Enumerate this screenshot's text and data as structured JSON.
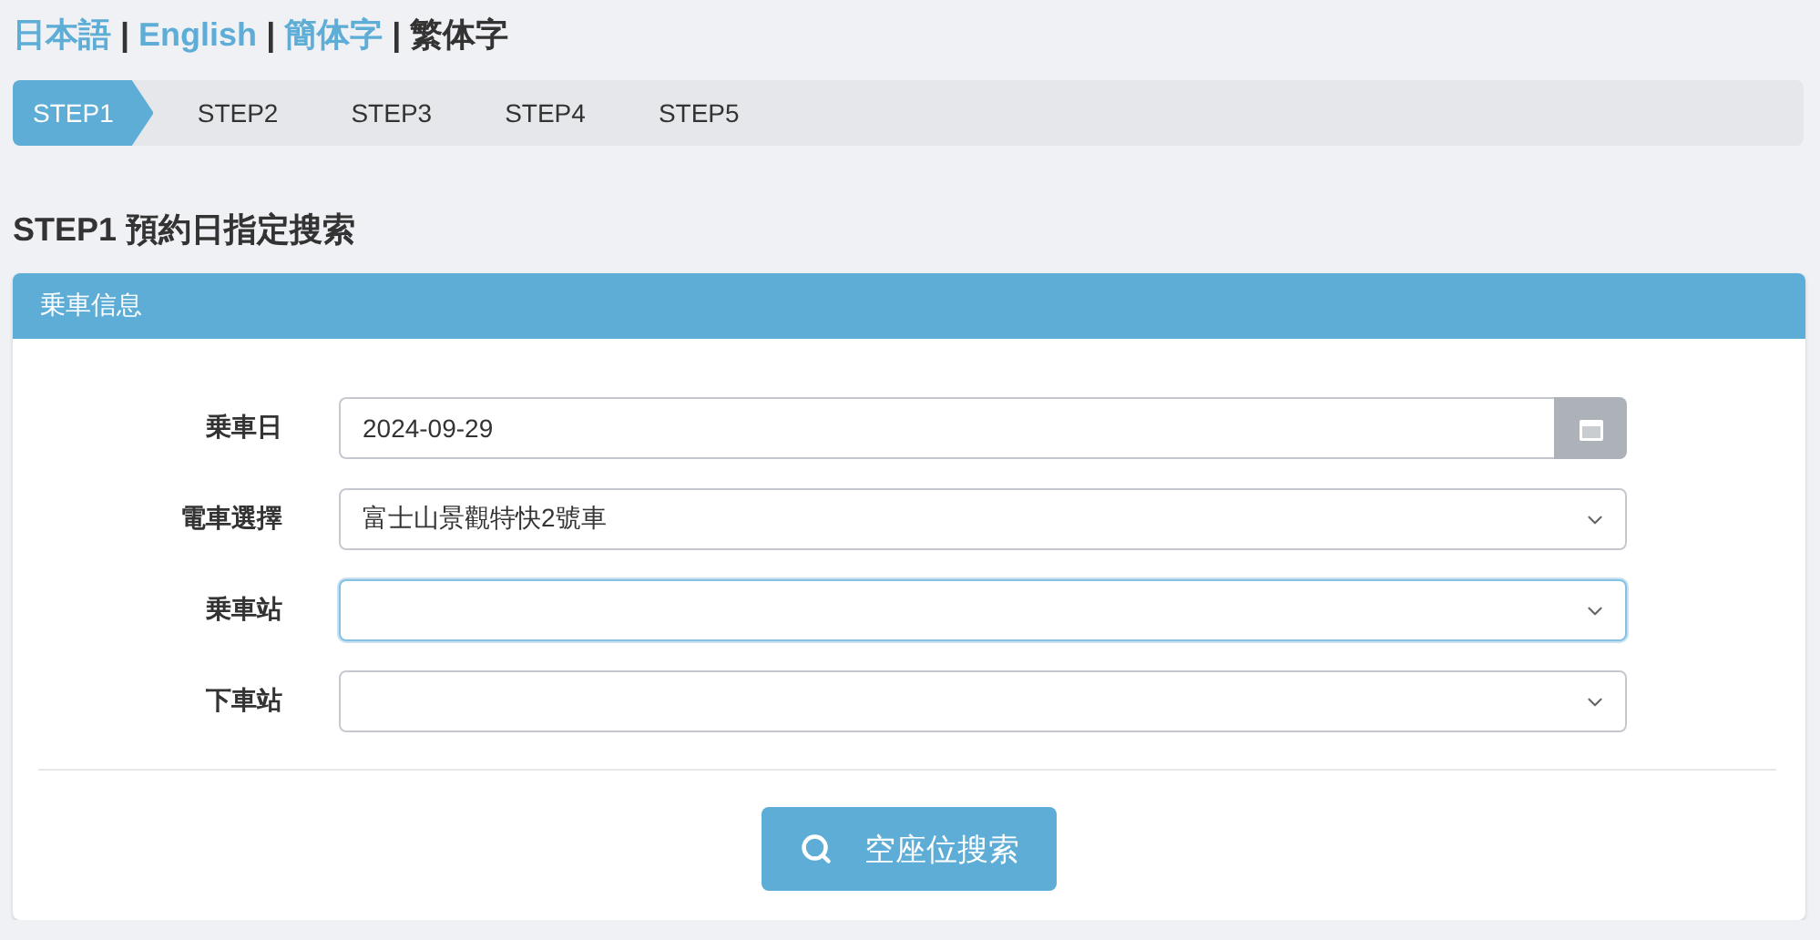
{
  "languages": [
    {
      "label": "日本語",
      "selected": false
    },
    {
      "label": "English",
      "selected": false
    },
    {
      "label": "簡体字",
      "selected": false
    },
    {
      "label": "繁体字",
      "selected": true
    }
  ],
  "separator": "|",
  "steps": [
    {
      "label": "STEP1",
      "selected": true
    },
    {
      "label": "STEP2",
      "selected": false
    },
    {
      "label": "STEP3",
      "selected": false
    },
    {
      "label": "STEP4",
      "selected": false
    },
    {
      "label": "STEP5",
      "selected": false
    }
  ],
  "page_title": "STEP1 預約日指定搜索",
  "panel": {
    "title": "乗車信息",
    "fields": [
      {
        "kind": "date",
        "label": "乗車日",
        "value": "2024-09-29"
      },
      {
        "kind": "select",
        "label": "電車選擇",
        "value": "富士山景觀特快2號車",
        "focused": false
      },
      {
        "kind": "select",
        "label": "乗車站",
        "focused": true
      },
      {
        "kind": "select",
        "label": "下車站",
        "focused": false
      }
    ],
    "search_button": "空座位搜索"
  }
}
